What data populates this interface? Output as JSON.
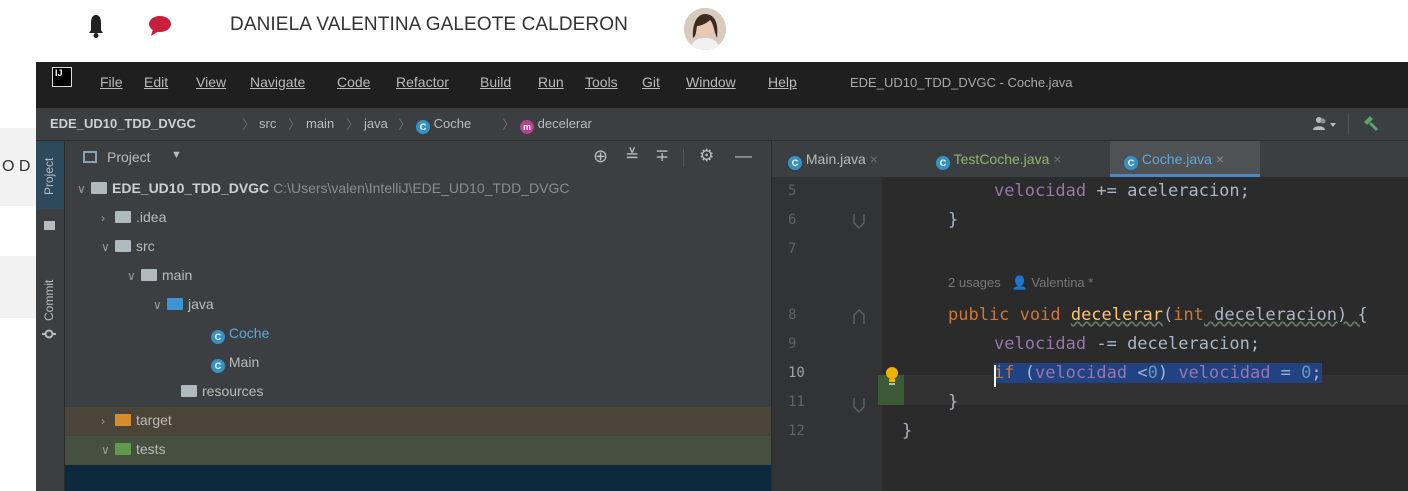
{
  "page": {
    "user_name": "DANIELA VALENTINA GALEOTE CALDERON",
    "left_text": "O D"
  },
  "ide": {
    "logo": "IJ",
    "menu": [
      "File",
      "Edit",
      "View",
      "Navigate",
      "Code",
      "Refactor",
      "Build",
      "Run",
      "Tools",
      "Git",
      "Window",
      "Help"
    ],
    "window_title": "EDE_UD10_TDD_DVGC - Coche.java",
    "breadcrumb": {
      "project": "EDE_UD10_TDD_DVGC",
      "src": "src",
      "main": "main",
      "java": "java",
      "class": "Coche",
      "method": "decelerar"
    },
    "side_tabs": {
      "project": "Project",
      "commit": "Commit"
    },
    "project_panel": {
      "title": "Project",
      "tree": [
        {
          "label": "EDE_UD10_TDD_DVGC",
          "path": "C:\\Users\\valen\\IntelliJ\\EDE_UD10_TDD_DVGC"
        },
        {
          "label": ".idea"
        },
        {
          "label": "src"
        },
        {
          "label": "main"
        },
        {
          "label": "java"
        },
        {
          "label": "Coche"
        },
        {
          "label": "Main"
        },
        {
          "label": "resources"
        },
        {
          "label": "target"
        },
        {
          "label": "tests"
        }
      ]
    },
    "editor": {
      "tabs": [
        "Main.java",
        "TestCoche.java",
        "Coche.java"
      ],
      "line_numbers": [
        "5",
        "6",
        "7",
        "8",
        "9",
        "10",
        "11",
        "12"
      ],
      "usage_hint": "2 usages",
      "author_hint": "Valentina *",
      "code": {
        "l5_field": "velocidad",
        "l5_rest": " += aceleracion;",
        "l6": "}",
        "l8_kw": "public void ",
        "l8_fn": "decelerar",
        "l8_paren": "(",
        "l8_type": "int",
        "l8_param": " deceleracion) {",
        "l9_field": "velocidad",
        "l9_rest": " -= deceleracion;",
        "l10_kw": "if",
        "l10_a": " (",
        "l10_field1": "velocidad",
        "l10_b": " <",
        "l10_num1": "0",
        "l10_c": ") ",
        "l10_field2": "velocidad",
        "l10_d": " = ",
        "l10_num2": "0",
        "l10_e": ";",
        "l11": "}",
        "l12": "}"
      }
    },
    "colors": {
      "menubar_bg": "#1f1f1f",
      "panel_bg": "#3c3f41",
      "editor_bg": "#2b2b2b",
      "selection": "#214283",
      "keyword": "#cc7832",
      "field": "#9876aa",
      "method": "#ffc66d",
      "number": "#6897bb"
    }
  }
}
